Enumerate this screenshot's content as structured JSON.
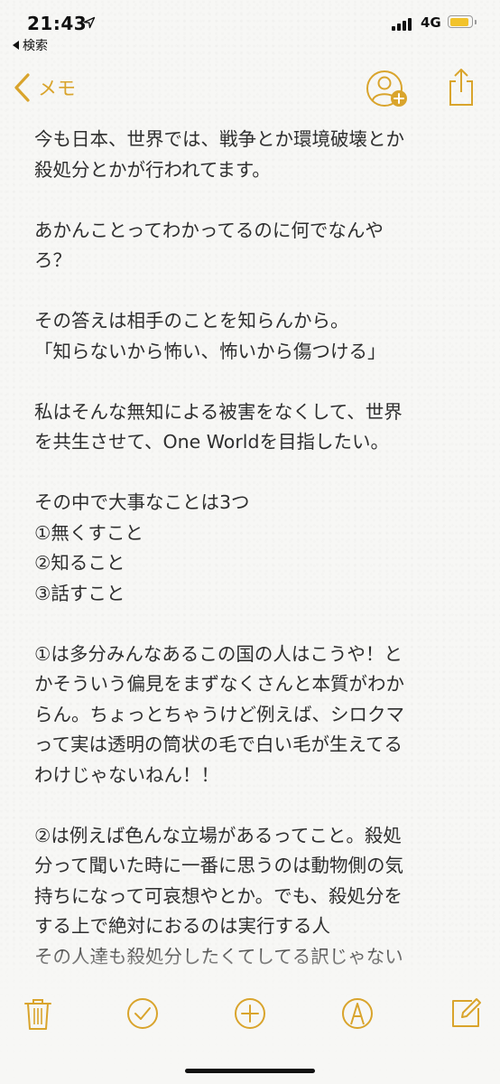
{
  "status": {
    "time": "21:43",
    "back_app": "検索",
    "network": "4G"
  },
  "nav": {
    "back_label": "メモ"
  },
  "note": {
    "paragraphs": [
      "今も日本、世界では、戦争とか環境破壊とか\n殺処分とかが行われてます。",
      "あかんことってわかってるのに何でなんや\nろ？",
      "その答えは相手のことを知らんから。\n「知らないから怖い、怖いから傷つける」",
      "私はそんな無知による被害をなくして、世界\nを共生させて、One Worldを目指したい。",
      "その中で大事なことは3つ\n①無くすこと\n②知ること\n③話すこと",
      "①は多分みんなあるこの国の人はこうや！と\nかそういう偏見をまずなくさんと本質がわか\nらん。ちょっとちゃうけど例えば、シロクマ\nって実は透明の筒状の毛で白い毛が生えてる\nわけじゃないねん！！",
      "②は例えば色んな立場があるってこと。殺処\n分って聞いた時に一番に思うのは動物側の気\n持ちになって可哀想やとか。でも、殺処分を\nする上で絶対におるのは実行する人\nその人達も殺処分したくてしてる訳じゃない"
    ]
  },
  "colors": {
    "accent": "#d9a42c",
    "battery": "#f2c32b",
    "text": "#2f2f2f"
  },
  "icons": {
    "trash": "trash-icon",
    "checklist": "checkmark-circle-icon",
    "add": "plus-circle-icon",
    "markup": "pen-circle-icon",
    "compose": "compose-icon",
    "share": "share-icon",
    "add_person": "add-person-icon"
  }
}
